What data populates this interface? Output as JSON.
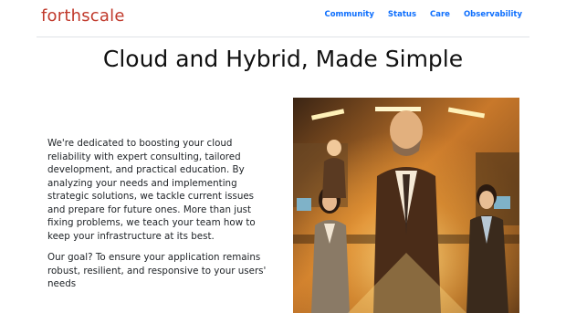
{
  "header": {
    "brand": "forthscale",
    "nav": [
      "Community",
      "Status",
      "Care",
      "Observability"
    ]
  },
  "hero": {
    "title": "Cloud and Hybrid, Made Simple",
    "paragraphs": [
      "We're dedicated to boosting your cloud reliability with expert consulting, tailored development, and practical education. By analyzing your needs and implementing strategic solutions, we tackle current issues and prepare for future ones. More than just fixing problems, we teach your team how to keep your infrastructure at its best.",
      "Our goal? To ensure your application remains robust, resilient, and responsive to your users' needs"
    ]
  },
  "colors": {
    "brand": "#c0392b",
    "link": "#0d6efd"
  }
}
